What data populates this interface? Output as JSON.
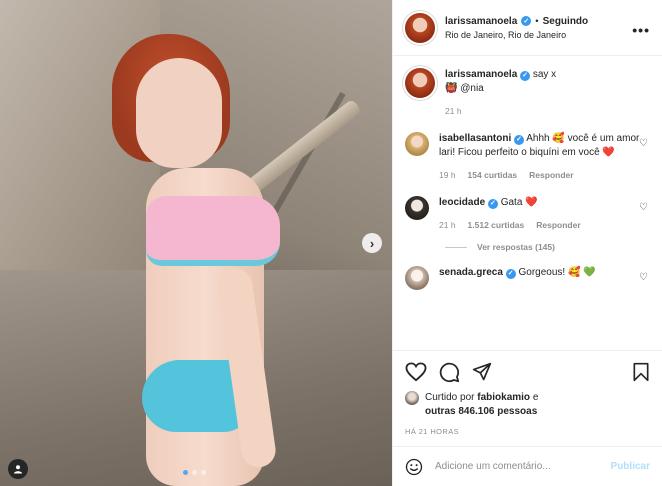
{
  "header": {
    "username": "larissamanoela",
    "follow_dot": "•",
    "follow_label": "Seguindo",
    "location": "Rio de Janeiro, Rio de Janeiro",
    "more_icon": "more-horizontal-icon"
  },
  "caption": {
    "username": "larissamanoela",
    "text": "say x",
    "mention_emoji": "👹",
    "mention": "@nia",
    "time": "21 h"
  },
  "comments": [
    {
      "username": "isabellasantoni",
      "text_before": "Ahhh",
      "emoji1": "🥰",
      "text_after": "você é um amor lari! Ficou perfeito o biquíni em você",
      "emoji2": "❤️",
      "time": "19 h",
      "likes": "154 curtidas",
      "reply": "Responder"
    },
    {
      "username": "leocidade",
      "text_before": "Gata",
      "emoji1": "❤️",
      "time": "21 h",
      "likes": "1.512 curtidas",
      "reply": "Responder",
      "view_replies": "Ver respostas (145)"
    },
    {
      "username": "senada.greca",
      "text_before": "Gorgeous!",
      "emoji1": "🥰",
      "emoji2": "💚"
    }
  ],
  "liked_by": {
    "prefix": "Curtido por",
    "user": "fabiokamio",
    "middle": "e",
    "others": "outras 846.106 pessoas"
  },
  "post_time": "HÁ 21 HORAS",
  "add_comment": {
    "placeholder": "Adicione um comentário...",
    "publish": "Publicar",
    "emoji_icon": "smile-icon"
  },
  "carousel": {
    "next_glyph": "›",
    "dot_count": 3,
    "active_index": 0
  },
  "colors": {
    "verified": "#3897f0",
    "publish_disabled": "#b2dffc",
    "carousel_active_dot": "#58a6f0"
  }
}
